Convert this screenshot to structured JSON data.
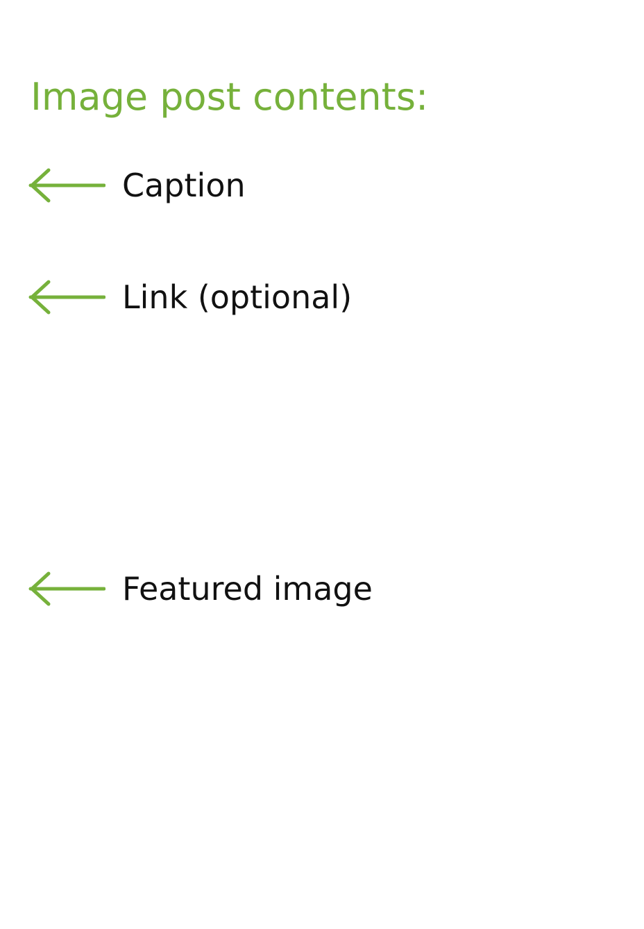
{
  "title": "Image post contents:",
  "accent_color": "#76b13b",
  "items": [
    {
      "label": "Caption",
      "icon": "arrow-left-icon"
    },
    {
      "label": "Link (optional)",
      "icon": "arrow-left-icon"
    },
    {
      "label": "Featured image",
      "icon": "arrow-left-icon"
    }
  ]
}
